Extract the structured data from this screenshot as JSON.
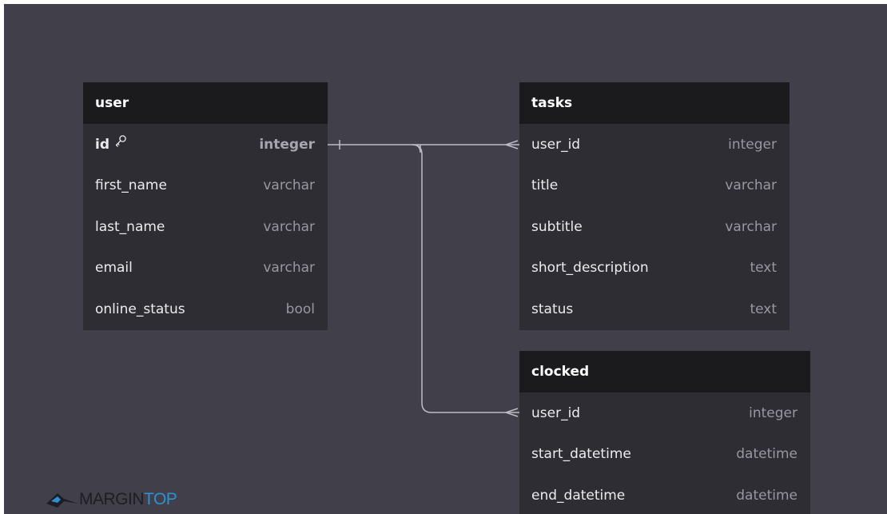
{
  "tables": {
    "user": {
      "name": "user",
      "columns": [
        {
          "name": "id",
          "type": "integer",
          "primary_key": true,
          "icon": "key-icon"
        },
        {
          "name": "first_name",
          "type": "varchar"
        },
        {
          "name": "last_name",
          "type": "varchar"
        },
        {
          "name": "email",
          "type": "varchar"
        },
        {
          "name": "online_status",
          "type": "bool"
        }
      ]
    },
    "tasks": {
      "name": "tasks",
      "columns": [
        {
          "name": "user_id",
          "type": "integer"
        },
        {
          "name": "title",
          "type": "varchar"
        },
        {
          "name": "subtitle",
          "type": "varchar"
        },
        {
          "name": "short_description",
          "type": "text"
        },
        {
          "name": "status",
          "type": "text"
        }
      ]
    },
    "clocked": {
      "name": "clocked",
      "columns": [
        {
          "name": "user_id",
          "type": "integer"
        },
        {
          "name": "start_datetime",
          "type": "datetime"
        },
        {
          "name": "end_datetime",
          "type": "datetime"
        }
      ]
    }
  },
  "relationships": [
    {
      "from": "user.id",
      "to": "tasks.user_id",
      "cardinality": "one-to-many"
    },
    {
      "from": "user.id",
      "to": "clocked.user_id",
      "cardinality": "one-to-many"
    }
  ],
  "logo": {
    "part1": "MARGIN",
    "part2": "TOP",
    "icon": "mountain-logo-icon"
  },
  "colors": {
    "canvas_bg": "#41404a",
    "table_header_bg": "#1b1b1d",
    "table_body_bg": "#2e2d33",
    "connector": "#bdbcc4",
    "logo_dark": "#1d1d24",
    "logo_blue": "#2e8fd1"
  }
}
